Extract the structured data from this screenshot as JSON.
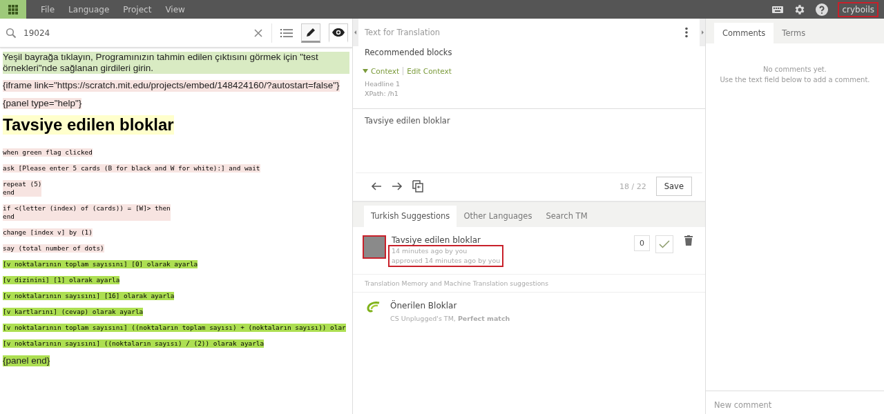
{
  "menu_bar": {
    "menus": [
      "File",
      "Language",
      "Project",
      "View"
    ],
    "user": {
      "name": "cryboils",
      "highlighted": true
    }
  },
  "search": {
    "value": "19024"
  },
  "view_toggles": [
    {
      "kind": "edit",
      "selected": true
    },
    {
      "kind": "preview",
      "selected": false
    }
  ],
  "preview": [
    {
      "kind": "text",
      "color": "#d9ebc3",
      "text": "Yeşil bayrağa tıklayın, Programınızın tahmin edilen çıktısını görmek için \"test örnekleri\"nde sağlanan girdileri girin."
    },
    {
      "kind": "text",
      "color": "#f7e4e1",
      "text": "{iframe link=\"https://scratch.mit.edu/projects/embed/148424160/?autostart=false\"}"
    },
    {
      "kind": "text",
      "color": "#f7e4e1",
      "text": "{panel type=\"help\"}"
    },
    {
      "kind": "heading",
      "color": "#ffffcc",
      "text": "Tavsiye edilen bloklar"
    },
    {
      "kind": "code",
      "color": "#f7e4e1",
      "text": "when green flag clicked"
    },
    {
      "kind": "code",
      "color": "#f7e4e1",
      "text": "ask [Please enter 5 cards (B for black and W for white):] and wait"
    },
    {
      "kind": "code",
      "color": "#f7e4e1",
      "text": "repeat (5)\nend"
    },
    {
      "kind": "code",
      "color": "#f7e4e1",
      "text": "if <(letter (index) of (cards)) = [W]> then\nend"
    },
    {
      "kind": "code",
      "color": "#f7e4e1",
      "text": "change [index v] by (1)"
    },
    {
      "kind": "code",
      "color": "#f7e4e1",
      "text": "say (total number of dots)"
    },
    {
      "kind": "code",
      "color": "#addf52",
      "text": "[v noktalarının toplam sayısını] [0] olarak ayarla"
    },
    {
      "kind": "code",
      "color": "#addf52",
      "text": "[v dizinini] [1] olarak ayarla"
    },
    {
      "kind": "code",
      "color": "#addf52",
      "text": "[v noktalarının sayısını] [16] olarak ayarla"
    },
    {
      "kind": "code",
      "color": "#addf52",
      "text": "[v kartlarını] (cevap) olarak ayarla"
    },
    {
      "kind": "code",
      "color": "#addf52",
      "text": "[v noktalarının toplam sayısını] ((noktaların toplam sayısı) + (noktaların sayısı)) olar"
    },
    {
      "kind": "code",
      "color": "#addf52",
      "text": "[v noktalarının sayısını] ((noktaların sayısı) / (2)) olarak ayarla"
    },
    {
      "kind": "text",
      "color": "#addf52",
      "text": "{panel end}"
    }
  ],
  "editor": {
    "header": "Text for Translation",
    "source": "Recommended blocks",
    "context": {
      "label": "Context",
      "expanded": true,
      "edit_label": "Edit Context",
      "lines": [
        "Headline 1",
        "XPath: /h1"
      ]
    },
    "translation": "Tavsiye edilen bloklar",
    "counter": "18 / 22",
    "save": "Save"
  },
  "suggestion_tabs": [
    {
      "label": "Turkish Suggestions",
      "selected": true
    },
    {
      "label": "Other Languages",
      "selected": false
    },
    {
      "label": "Search TM",
      "selected": false
    }
  ],
  "suggestions": [
    {
      "text": "Tavsiye edilen bloklar",
      "meta": [
        "14 minutes ago by you",
        "approved 14 minutes ago by you"
      ],
      "votes": "0",
      "avatar_highlighted": true,
      "meta_highlighted": true
    }
  ],
  "tm_header": "Translation Memory and Machine Translation suggestions",
  "tm_results": [
    {
      "text": "Önerilen Bloklar",
      "source": "CS Unplugged's TM, **Perfect match**"
    }
  ],
  "sidebar": {
    "tabs": [
      {
        "label": "Comments",
        "selected": true
      },
      {
        "label": "Terms",
        "selected": false
      }
    ],
    "empty": [
      "No comments yet.",
      "Use the text field below to add a comment."
    ],
    "new_comment_placeholder": "New comment"
  }
}
